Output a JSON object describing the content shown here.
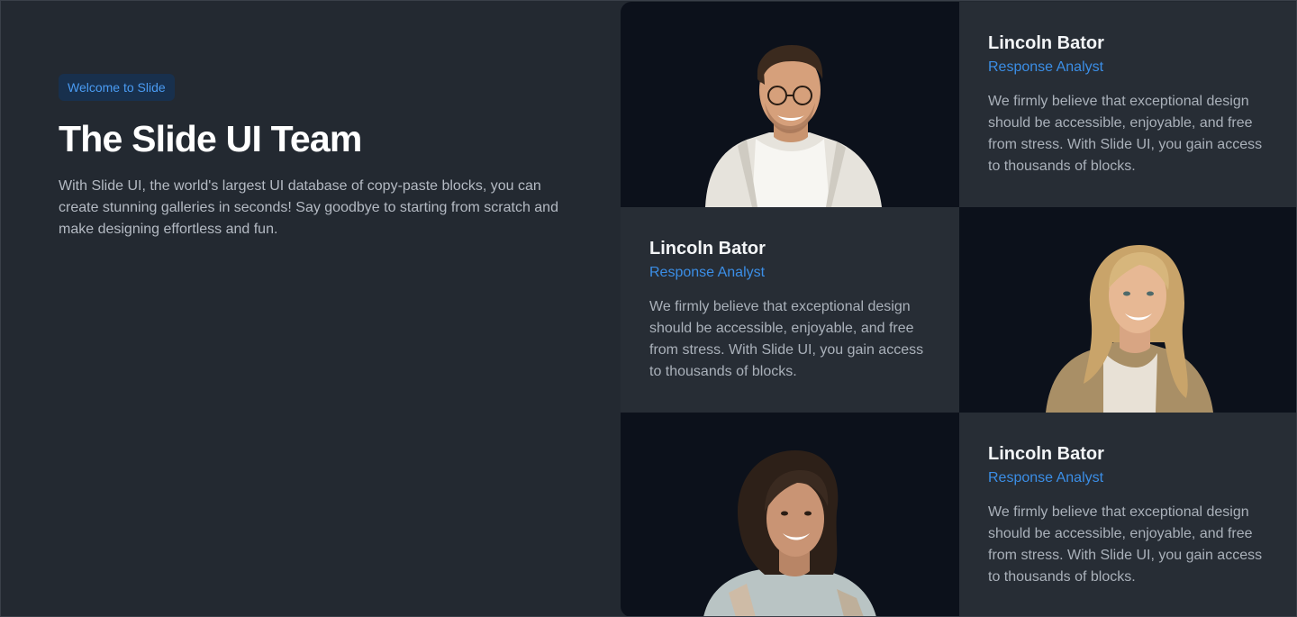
{
  "intro": {
    "badge": "Welcome to Slide",
    "title": "The Slide UI Team",
    "description": "With Slide UI, the world's largest UI database of copy-paste blocks, you can create stunning galleries in seconds! Say goodbye to starting from scratch and make designing effortless and fun."
  },
  "members": [
    {
      "name": "Lincoln Bator",
      "role": "Response Analyst",
      "bio": "We firmly believe that exceptional design should be accessible, enjoyable, and free from stress. With Slide UI, you gain access to thousands of blocks."
    },
    {
      "name": "Lincoln Bator",
      "role": "Response Analyst",
      "bio": "We firmly believe that exceptional design should be accessible, enjoyable, and free from stress. With Slide UI, you gain access to thousands of blocks."
    },
    {
      "name": "Lincoln Bator",
      "role": "Response Analyst",
      "bio": "We firmly believe that exceptional design should be accessible, enjoyable, and free from stress. With Slide UI, you gain access to thousands of blocks."
    }
  ],
  "colors": {
    "page_background": "#232931",
    "photo_background": "#0c111b",
    "accent": "#3b8ee6",
    "badge_background": "#18304d"
  }
}
